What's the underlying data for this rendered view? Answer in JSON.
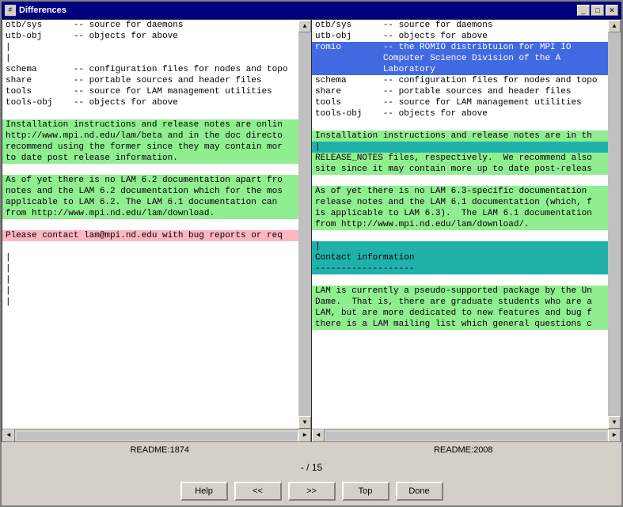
{
  "window": {
    "title": "Differences",
    "icon": "≠",
    "minimize_label": "_",
    "maximize_label": "□",
    "close_label": "✕"
  },
  "left_panel": {
    "lines": [
      {
        "text": "otb/sys      -- source for daemons",
        "style": "normal"
      },
      {
        "text": "utb-obj      -- objects for above",
        "style": "normal"
      },
      {
        "text": "|",
        "style": "normal"
      },
      {
        "text": "|",
        "style": "normal"
      },
      {
        "text": "schema       -- configuration files for nodes and topo",
        "style": "normal"
      },
      {
        "text": "share        -- portable sources and header files",
        "style": "normal"
      },
      {
        "text": "tools        -- source for LAM management utilities",
        "style": "normal"
      },
      {
        "text": "tools-obj    -- objects for above",
        "style": "normal"
      },
      {
        "text": "",
        "style": "normal"
      },
      {
        "text": "Installation instructions and release notes are onlin",
        "style": "green"
      },
      {
        "text": "http://www.mpi.nd.edu/lam/beta and in the doc directo",
        "style": "green"
      },
      {
        "text": "recommend using the former since they may contain mor",
        "style": "green"
      },
      {
        "text": "to date post release information.",
        "style": "green"
      },
      {
        "text": "",
        "style": "normal"
      },
      {
        "text": "As of yet there is no LAM 6.2 documentation apart fro",
        "style": "green"
      },
      {
        "text": "notes and the LAM 6.2 documentation which for the mos",
        "style": "green"
      },
      {
        "text": "applicable to LAM 6.2. The LAM 6.1 documentation can",
        "style": "green"
      },
      {
        "text": "from http://www.mpi.nd.edu/lam/download.",
        "style": "green"
      },
      {
        "text": "",
        "style": "normal"
      },
      {
        "text": "Please contact lam@mpi.nd.edu with bug reports or req",
        "style": "red"
      },
      {
        "text": "",
        "style": "normal"
      },
      {
        "text": "|",
        "style": "normal"
      },
      {
        "text": "|",
        "style": "normal"
      },
      {
        "text": "|",
        "style": "normal"
      },
      {
        "text": "|",
        "style": "normal"
      },
      {
        "text": "|",
        "style": "normal"
      }
    ],
    "status": "README:1874"
  },
  "right_panel": {
    "lines": [
      {
        "text": "otb/sys      -- source for daemons",
        "style": "normal"
      },
      {
        "text": "utb-obj      -- objects for above",
        "style": "normal"
      },
      {
        "text": "romio        -- the ROMIO distribtuion for MPI IO",
        "style": "blue"
      },
      {
        "text": "             Computer Science Division of the A",
        "style": "blue"
      },
      {
        "text": "             Laboratory",
        "style": "blue"
      },
      {
        "text": "schema       -- configuration files for nodes and topo",
        "style": "normal"
      },
      {
        "text": "share        -- portable sources and header files",
        "style": "normal"
      },
      {
        "text": "tools        -- source for LAM management utilities",
        "style": "normal"
      },
      {
        "text": "tools-obj    -- objects for above",
        "style": "normal"
      },
      {
        "text": "",
        "style": "normal"
      },
      {
        "text": "Installation instructions and release notes are in th",
        "style": "green"
      },
      {
        "text": "|",
        "style": "teal"
      },
      {
        "text": "RELEASE_NOTES files, respectively.  We recommend also",
        "style": "green"
      },
      {
        "text": "site since it may contain more up to date post-releas",
        "style": "green"
      },
      {
        "text": "",
        "style": "normal"
      },
      {
        "text": "As of yet there is no LAM 6.3-specific documentation",
        "style": "green"
      },
      {
        "text": "release notes and the LAM 6.1 documentation (which, f",
        "style": "green"
      },
      {
        "text": "is applicable to LAM 6.3).  The LAM 6.1 documentation",
        "style": "green"
      },
      {
        "text": "from http://www.mpi.nd.edu/lam/download/.",
        "style": "green"
      },
      {
        "text": "",
        "style": "normal"
      },
      {
        "text": "|",
        "style": "teal"
      },
      {
        "text": "Contact information",
        "style": "teal"
      },
      {
        "text": "-------------------",
        "style": "teal"
      },
      {
        "text": "",
        "style": "normal"
      },
      {
        "text": "LAM is currently a pseudo-supported package by the Un",
        "style": "green"
      },
      {
        "text": "Dame.  That is, there are graduate students who are a",
        "style": "green"
      },
      {
        "text": "LAM, but are more dedicated to new features and bug f",
        "style": "green"
      },
      {
        "text": "there is a LAM mailing list which general questions c",
        "style": "green"
      }
    ],
    "status": "README:2008"
  },
  "navigation": {
    "current": "-",
    "separator": "/",
    "total": "15"
  },
  "buttons": {
    "help": "Help",
    "prev": "<<",
    "next": ">>",
    "top": "Top",
    "done": "Done"
  }
}
